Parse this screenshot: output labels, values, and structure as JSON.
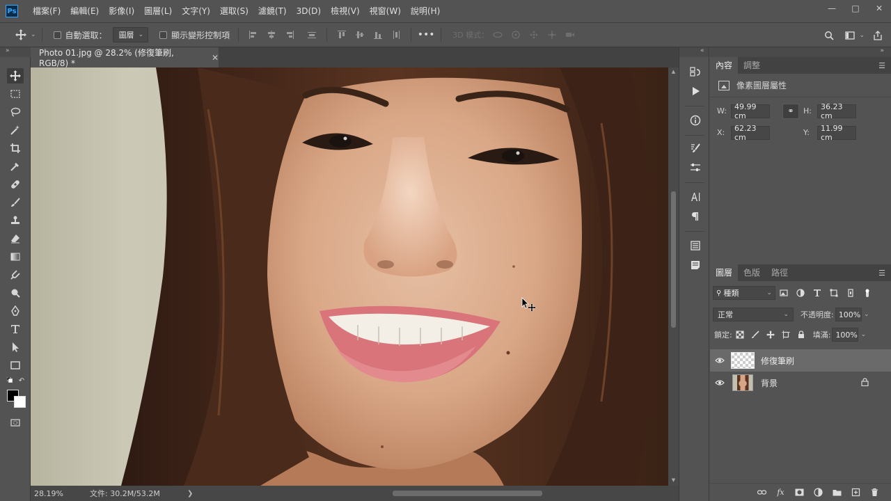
{
  "app": {
    "logo": "Ps",
    "menu": [
      "檔案(F)",
      "編輯(E)",
      "影像(I)",
      "圖層(L)",
      "文字(Y)",
      "選取(S)",
      "濾鏡(T)",
      "3D(D)",
      "檢視(V)",
      "視窗(W)",
      "說明(H)"
    ]
  },
  "options": {
    "auto_select_label": "自動選取：",
    "auto_select_target": "圖層",
    "show_transform_label": "顯示變形控制項",
    "mode_3d_label": "3D 模式："
  },
  "document": {
    "tab_title": "Photo 01.jpg @ 28.2% (修復筆刷, RGB/8) *",
    "zoom": "28.19%",
    "doc_size": "文件: 30.2M/53.2M",
    "status_arrow": "❯"
  },
  "properties": {
    "tabs": [
      "內容",
      "調整"
    ],
    "header": "像素圖層屬性",
    "w_label": "W:",
    "w_value": "49.99 cm",
    "h_label": "H:",
    "h_value": "36.23 cm",
    "x_label": "X:",
    "x_value": "62.23 cm",
    "y_label": "Y:",
    "y_value": "11.99 cm"
  },
  "layers": {
    "tabs": [
      "圖層",
      "色版",
      "路徑"
    ],
    "filter_kind": "種類",
    "blend_mode": "正常",
    "opacity_label": "不透明度:",
    "opacity_value": "100%",
    "lock_label": "鎖定:",
    "fill_label": "填滿:",
    "fill_value": "100%",
    "items": [
      {
        "name": "修復筆刷",
        "selected": true,
        "locked": false
      },
      {
        "name": "背景",
        "selected": false,
        "locked": true
      }
    ],
    "footer_fx": "fx"
  },
  "colors": {
    "accent": "#31a8ff",
    "ui_bg": "#535353",
    "foreground": "#000000",
    "background": "#ffffff"
  }
}
